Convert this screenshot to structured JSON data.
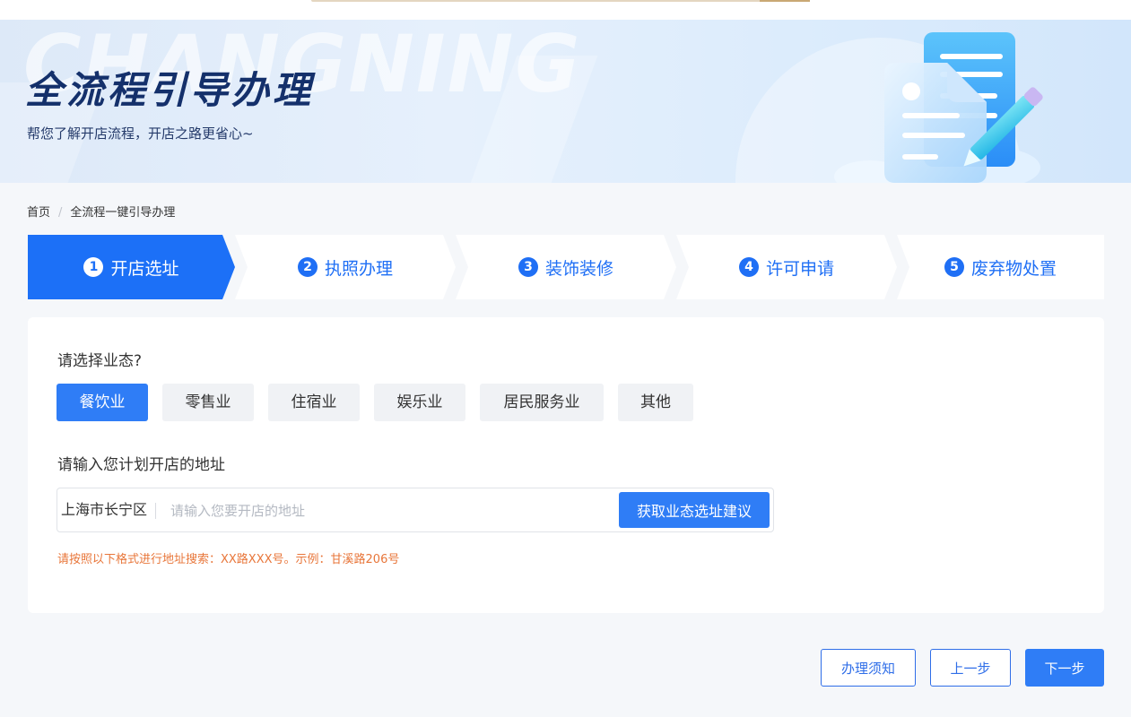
{
  "banner": {
    "watermark": "CHANGNING",
    "title": "全流程引导办理",
    "subtitle": "帮您了解开店流程，开店之路更省心~",
    "illustration_icon": "document-pencil-icon"
  },
  "breadcrumb": {
    "home": "首页",
    "separator": "/",
    "current": "全流程一键引导办理"
  },
  "steps": [
    {
      "num": "1",
      "label": "开店选址",
      "active": true
    },
    {
      "num": "2",
      "label": "执照办理",
      "active": false
    },
    {
      "num": "3",
      "label": "装饰装修",
      "active": false
    },
    {
      "num": "4",
      "label": "许可申请",
      "active": false
    },
    {
      "num": "5",
      "label": "废弃物处置",
      "active": false
    }
  ],
  "form": {
    "business_question": "请选择业态?",
    "business_types": [
      "餐饮业",
      "零售业",
      "住宿业",
      "娱乐业",
      "居民服务业",
      "其他"
    ],
    "selected_business_type": "餐饮业",
    "address_question": "请输入您计划开店的地址",
    "city": "上海市长宁区",
    "address_value": "",
    "address_placeholder": "请输入您要开店的地址",
    "suggest_button": "获取业态选址建议",
    "hint": "请按照以下格式进行地址搜索：XX路XXX号。示例：甘溪路206号"
  },
  "actions": {
    "notice": "办理须知",
    "prev": "上一步",
    "next": "下一步"
  },
  "colors": {
    "primary": "#2f7df6",
    "active_step": "#1c70f7",
    "title": "#14306b",
    "hint": "#e8763a",
    "chip_bg": "#f0f2f5"
  }
}
